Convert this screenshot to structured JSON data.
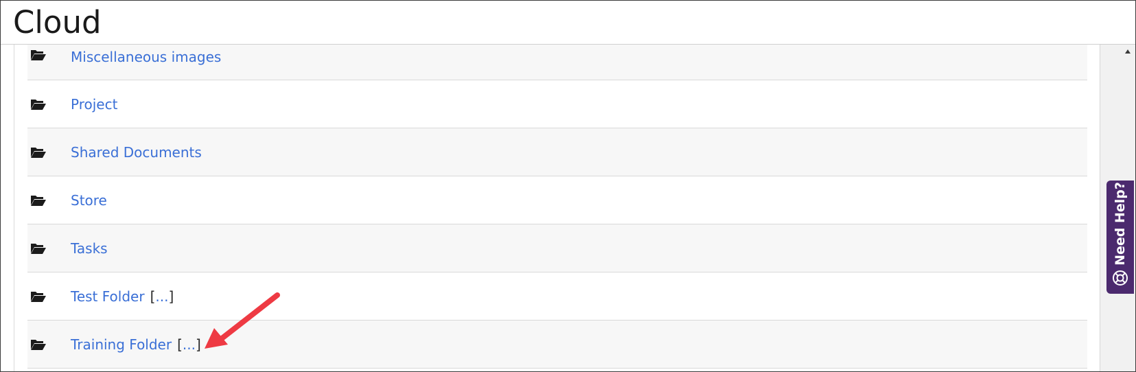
{
  "header": {
    "title": "Cloud"
  },
  "folders": [
    {
      "label": "Miscellaneous images",
      "ellipsis": ""
    },
    {
      "label": "Project",
      "ellipsis": ""
    },
    {
      "label": "Shared Documents",
      "ellipsis": ""
    },
    {
      "label": "Store",
      "ellipsis": ""
    },
    {
      "label": "Tasks",
      "ellipsis": ""
    },
    {
      "label": "Test Folder",
      "ellipsis": "..."
    },
    {
      "label": "Training Folder",
      "ellipsis": "..."
    }
  ],
  "help_tab": {
    "label": "Need Help?"
  },
  "icons": {
    "folder": "folder-open-icon",
    "help": "lifebuoy-icon",
    "scroll_up": "scroll-up-arrow-icon",
    "annotation": "red-arrow-icon"
  },
  "colors": {
    "link": "#3a6fd6",
    "help_tab": "#4b2a6e",
    "annotation_arrow": "#ee3a43",
    "row_alt": "#f7f7f7"
  }
}
